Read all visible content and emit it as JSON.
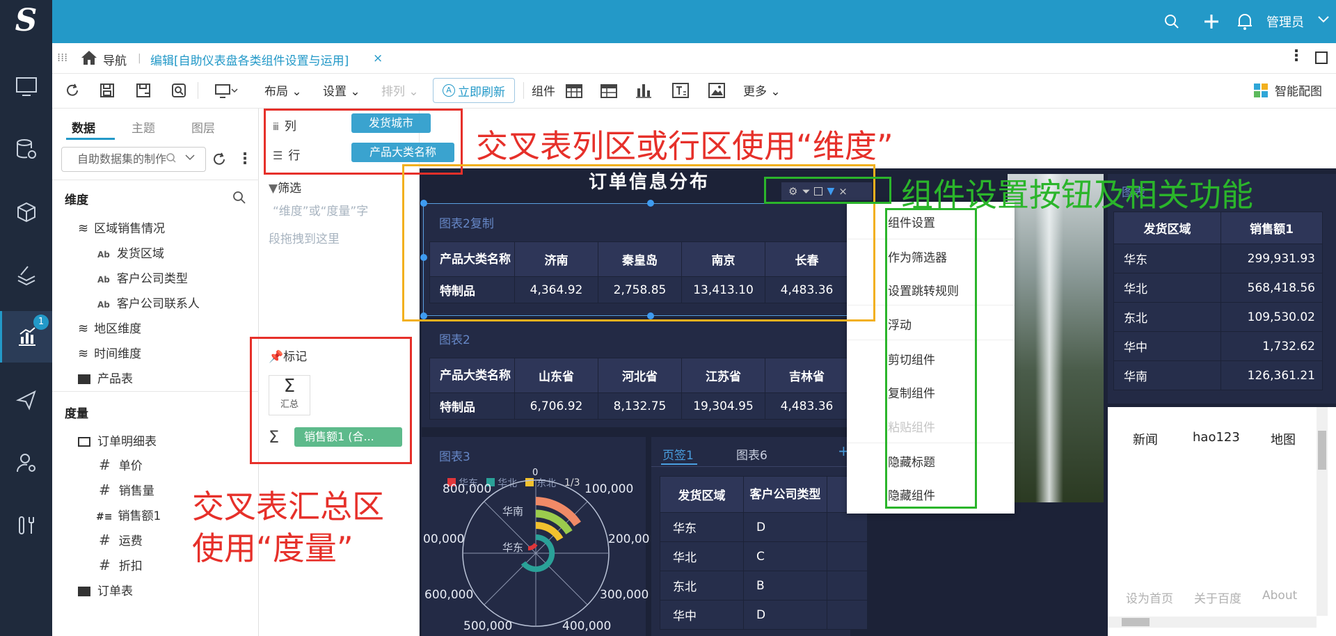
{
  "app": {
    "logo": "S",
    "user": "管理员"
  },
  "tabbar": {
    "nav_label": "导航",
    "edit_tab": "编辑[自助仪表盘各类组件设置与运用]",
    "close": "×"
  },
  "toolbar": {
    "layout": "布局",
    "settings": "设置",
    "arrange": "排列",
    "refresh_now": "立即刷新",
    "components": "组件",
    "more": "更多",
    "smart_chart": "智能配图"
  },
  "left_panel": {
    "tabs": [
      "数据",
      "主题",
      "图层"
    ],
    "dataset_placeholder": "自助数据集的制作",
    "dimension_header": "维度",
    "measure_header": "度量",
    "dimensions": [
      {
        "label": "区域销售情况",
        "kind": "layers"
      },
      {
        "label": "发货区域",
        "kind": "text"
      },
      {
        "label": "客户公司类型",
        "kind": "text"
      },
      {
        "label": "客户公司联系人",
        "kind": "text"
      },
      {
        "label": "地区维度",
        "kind": "layers"
      },
      {
        "label": "时间维度",
        "kind": "layers"
      },
      {
        "label": "产品表",
        "kind": "folder"
      }
    ],
    "measures": [
      {
        "label": "订单明细表",
        "kind": "folder"
      },
      {
        "label": "单价",
        "kind": "number"
      },
      {
        "label": "销售量",
        "kind": "number"
      },
      {
        "label": "销售额1",
        "kind": "number-special"
      },
      {
        "label": "运费",
        "kind": "number"
      },
      {
        "label": "折扣",
        "kind": "number"
      },
      {
        "label": "订单表",
        "kind": "folder"
      }
    ]
  },
  "field_panel": {
    "column_label": "列",
    "column_chip": "发货城市",
    "row_label": "行",
    "row_chip": "产品大类名称",
    "filter_label": "筛选",
    "filter_hint_1": "“维度”或“度量”字",
    "filter_hint_2": "段拖拽到这里",
    "mark_label": "标记",
    "sum_label": "汇总",
    "measure_chip": "销售额1 (合..."
  },
  "dashboard": {
    "title": "订单信息分布",
    "chart1": {
      "title": "图表2复制",
      "row_header": "产品大类名称",
      "columns": [
        "济南",
        "秦皇岛",
        "南京",
        "长春"
      ],
      "row_label": "特制品",
      "values": [
        "4,364.92",
        "2,758.85",
        "13,413.10",
        "4,483.36"
      ]
    },
    "chart2": {
      "title": "图表2",
      "row_header": "产品大类名称",
      "columns": [
        "山东省",
        "河北省",
        "江苏省",
        "吉林省"
      ],
      "row_label": "特制品",
      "values": [
        "6,706.92",
        "8,132.75",
        "19,304.95",
        "4,483.36"
      ]
    },
    "chart3": {
      "title": "图表3",
      "legend": [
        "华东",
        "华北",
        "东北"
      ],
      "legend_colors": [
        "#e0363a",
        "#2aa198",
        "#f2c12e"
      ],
      "page": "1/3",
      "ticks": [
        "800,000",
        "0",
        "100,000",
        "200,00",
        "300,000",
        "400,000",
        "500,000",
        "600,000",
        "00,000"
      ],
      "labels": [
        "华南",
        "华东"
      ]
    },
    "tabs_card": {
      "tabs": [
        "页签1",
        "图表6"
      ],
      "add": "+",
      "headers": [
        "发货区域",
        "客户公司类型"
      ],
      "rows": [
        [
          "华东",
          "D"
        ],
        [
          "华北",
          "C"
        ],
        [
          "东北",
          "B"
        ],
        [
          "华中",
          "D"
        ]
      ]
    },
    "right_table": {
      "title": "图表",
      "headers": [
        "发货区域",
        "销售额1"
      ],
      "rows": [
        [
          "华东",
          "299,931.93"
        ],
        [
          "华北",
          "568,418.56"
        ],
        [
          "东北",
          "109,530.02"
        ],
        [
          "华中",
          "1,732.62"
        ],
        [
          "华南",
          "126,361.21"
        ]
      ]
    },
    "web_card": {
      "links": [
        "新闻",
        "hao123",
        "地图"
      ],
      "footer": [
        "设为首页",
        "关于百度",
        "About"
      ]
    }
  },
  "context_menu": {
    "items": [
      {
        "label": "组件设置",
        "enabled": true
      },
      {
        "label": "作为筛选器",
        "enabled": true
      },
      {
        "label": "设置跳转规则",
        "enabled": true
      },
      {
        "label": "浮动",
        "enabled": true
      },
      {
        "label": "剪切组件",
        "enabled": true
      },
      {
        "label": "复制组件",
        "enabled": true
      },
      {
        "label": "粘贴组件",
        "enabled": false
      },
      {
        "label": "隐藏标题",
        "enabled": true
      },
      {
        "label": "隐藏组件",
        "enabled": true
      }
    ]
  },
  "annotations": {
    "a1": "交叉表列区或行区使用“维度”",
    "a2": "组件设置按钮及相关功能",
    "a3_line1": "交叉表汇总区",
    "a3_line2": "使用“度量”"
  },
  "colors": {
    "brand": "#2399c8",
    "sidebar": "#1f2a3c",
    "dashboard_bg": "#1c2237",
    "annotation_red": "#e6302a",
    "annotation_green": "#2bb52b",
    "annotation_yellow": "#f2b01e"
  }
}
